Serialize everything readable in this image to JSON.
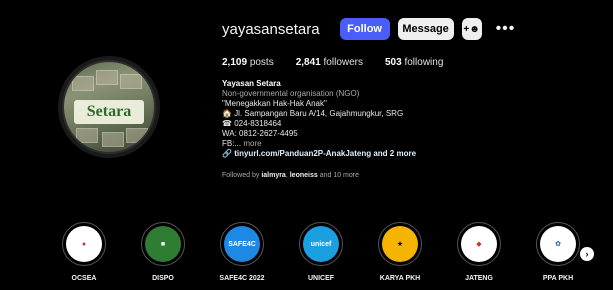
{
  "profile": {
    "username": "yayasansetara",
    "follow_label": "Follow",
    "message_label": "Message",
    "add_person_icon": "add-person-icon",
    "more_icon": "more-options-icon",
    "avatar_logo_text": "Setara"
  },
  "stats": {
    "posts_count": "2,109",
    "posts_label": "posts",
    "followers_count": "2,841",
    "followers_label": "followers",
    "following_count": "503",
    "following_label": "following"
  },
  "bio": {
    "name": "Yayasan Setara",
    "category": "Non-governmental organisation (NGO)",
    "line1": "\"Menegakkan Hak-Hak Anak\"",
    "line2": "🏠 Jl. Sampangan Baru A/14, Gajahmungkur, SRG",
    "line3": "☎ 024-8318464",
    "line4": "WA: 0812-2627-4495",
    "line5_prefix": "FB:...",
    "more_label": "more",
    "link_text": "tinyurl.com/Panduan2P-AnakJateng and 2 more",
    "followed_prefix": "Followed by",
    "followed_user1": "ialmyra",
    "followed_user2": "leoneiss",
    "followed_suffix": "and 10 more"
  },
  "highlights": [
    {
      "label": "OCSEA",
      "bg": "#ffffff",
      "text": "",
      "fg": "#c0392b"
    },
    {
      "label": "DISPO",
      "bg": "#2e7d32",
      "text": "",
      "fg": "#ffffff"
    },
    {
      "label": "SAFE4C 2022",
      "bg": "#1e88e5",
      "text": "SAFE4C",
      "fg": "#ffffff"
    },
    {
      "label": "UNICEF",
      "bg": "#1a9fe0",
      "text": "unicef",
      "fg": "#ffffff"
    },
    {
      "label": "KARYA PKH",
      "bg": "#f4b400",
      "text": "",
      "fg": "#000000"
    },
    {
      "label": "JATENG",
      "bg": "#ffffff",
      "text": "",
      "fg": "#c0392b"
    },
    {
      "label": "PPA PKH",
      "bg": "#ffffff",
      "text": "",
      "fg": "#1565c0"
    }
  ],
  "next_icon": "chevron-right-icon",
  "colors": {
    "follow_blue": "#4a5df9",
    "background": "#000000"
  }
}
